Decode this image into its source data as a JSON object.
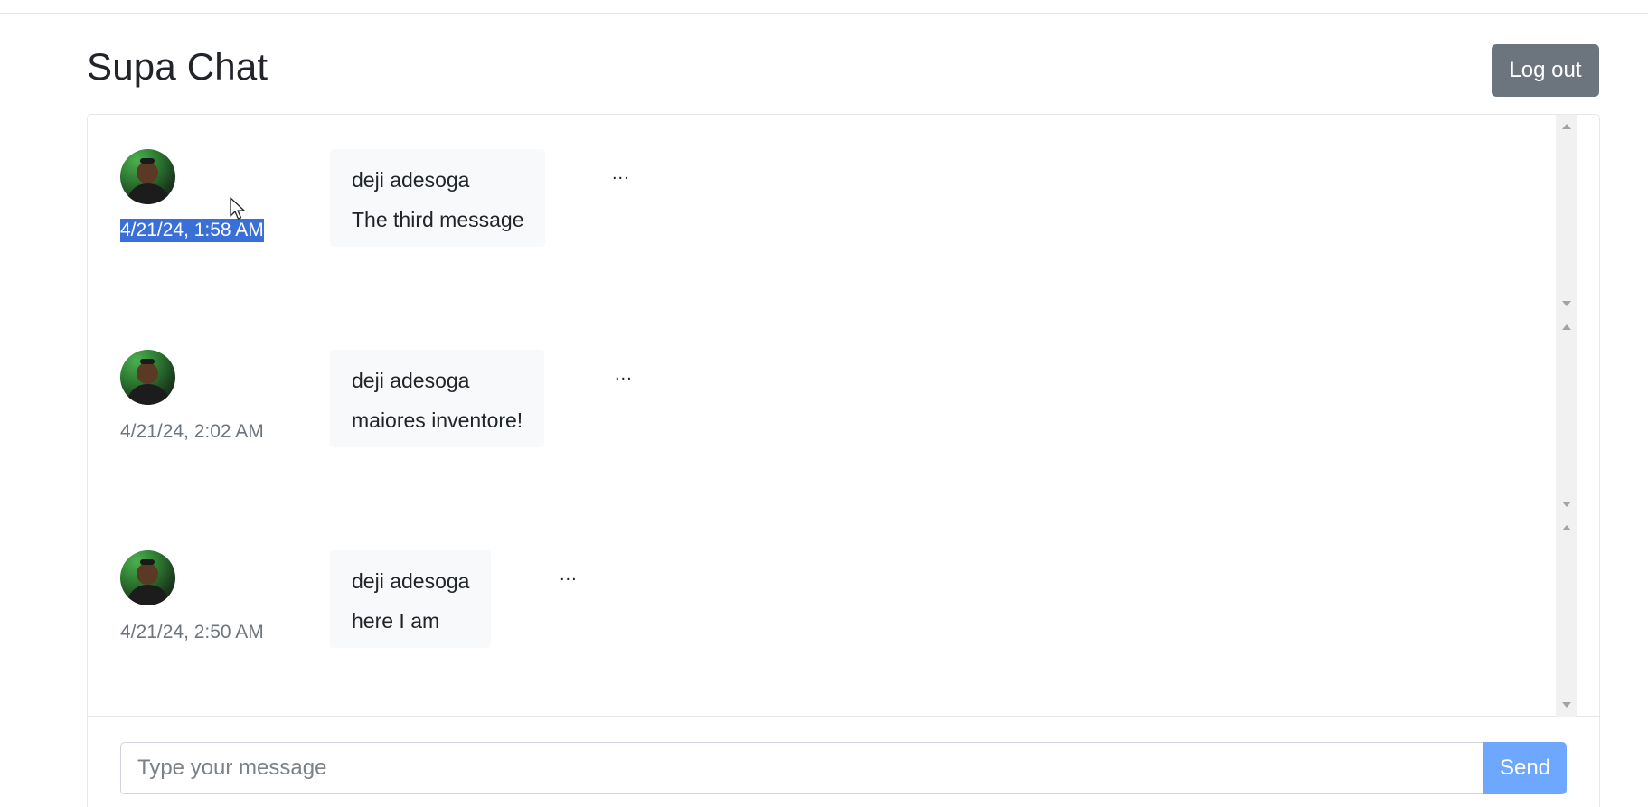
{
  "app": {
    "title": "Supa Chat",
    "logout_label": "Log out"
  },
  "messages": [
    {
      "author": "deji adesoga",
      "text": "The third message",
      "timestamp": "4/21/24, 1:58 AM",
      "timestamp_selected": true,
      "menu": "..."
    },
    {
      "author": "deji adesoga",
      "text": "maiores inventore!",
      "timestamp": "4/21/24, 2:02 AM",
      "timestamp_selected": false,
      "menu": "..."
    },
    {
      "author": "deji adesoga",
      "text": "here I am",
      "timestamp": "4/21/24, 2:50 AM",
      "timestamp_selected": false,
      "menu": "..."
    }
  ],
  "composer": {
    "placeholder": "Type your message",
    "value": "",
    "send_label": "Send"
  },
  "colors": {
    "logout_bg": "#6c757d",
    "send_bg": "#6ea8fe",
    "selection_bg": "#3a6fd8",
    "bubble_bg": "#f8f9fa"
  },
  "icons": {
    "avatar": "user-avatar",
    "menu": "ellipsis-icon",
    "scroll_up": "scroll-up-arrow-icon",
    "scroll_down": "scroll-down-arrow-icon"
  }
}
